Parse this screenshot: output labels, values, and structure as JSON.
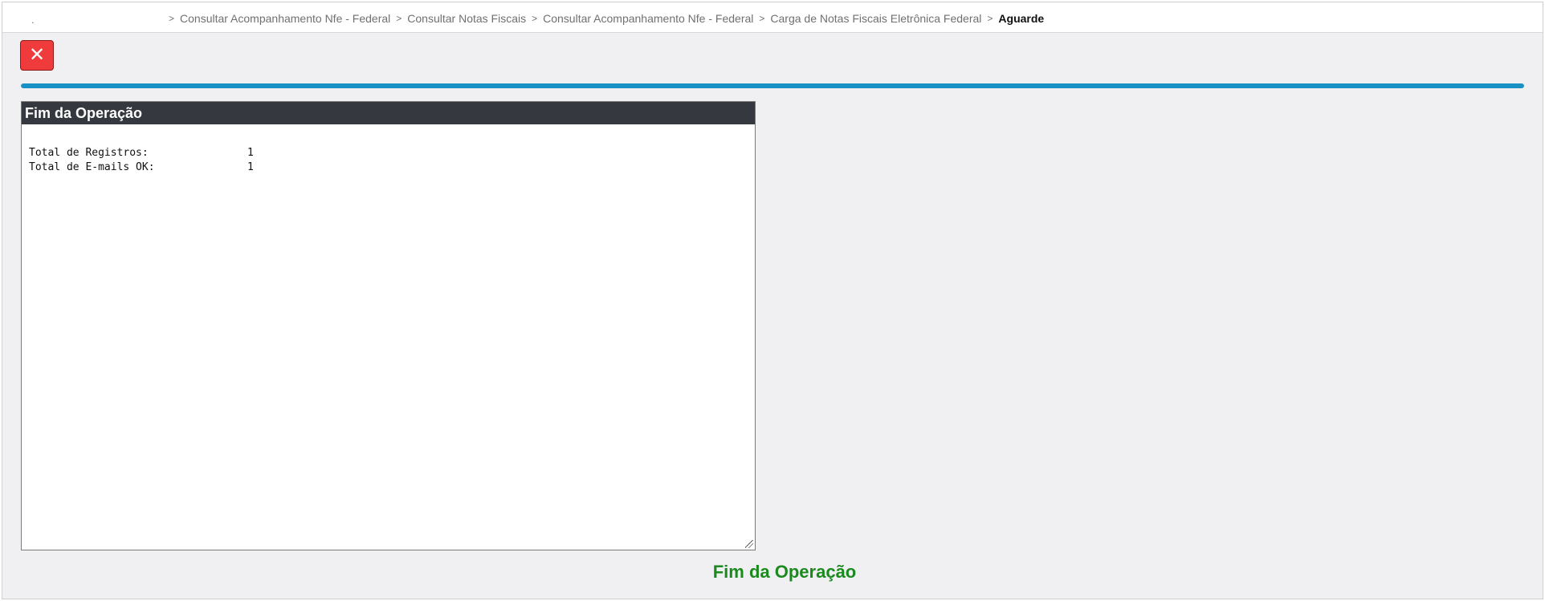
{
  "breadcrumb": {
    "home_glyph": ".",
    "separator": ">",
    "items": [
      "Consultar Acompanhamento Nfe - Federal",
      "Consultar Notas Fiscais",
      "Consultar Acompanhamento Nfe - Federal",
      "Carga de Notas Fiscais Eletrônica Federal"
    ],
    "current": "Aguarde"
  },
  "toolbar": {
    "close_icon": "close-icon",
    "close_glyph": "✕"
  },
  "progress": {
    "percent": 100,
    "color": "#1a91c4"
  },
  "panel": {
    "title": "Fim da Operação",
    "log": [
      {
        "label": "Total de Registros:",
        "value": "1"
      },
      {
        "label": "Total de E-mails OK:",
        "value": "1"
      }
    ]
  },
  "status": {
    "message": "Fim da Operação",
    "color": "#1a8a1f"
  },
  "colors": {
    "close_button": "#ef3b3b",
    "panel_header": "#35383e",
    "background": "#f0f0f2"
  }
}
